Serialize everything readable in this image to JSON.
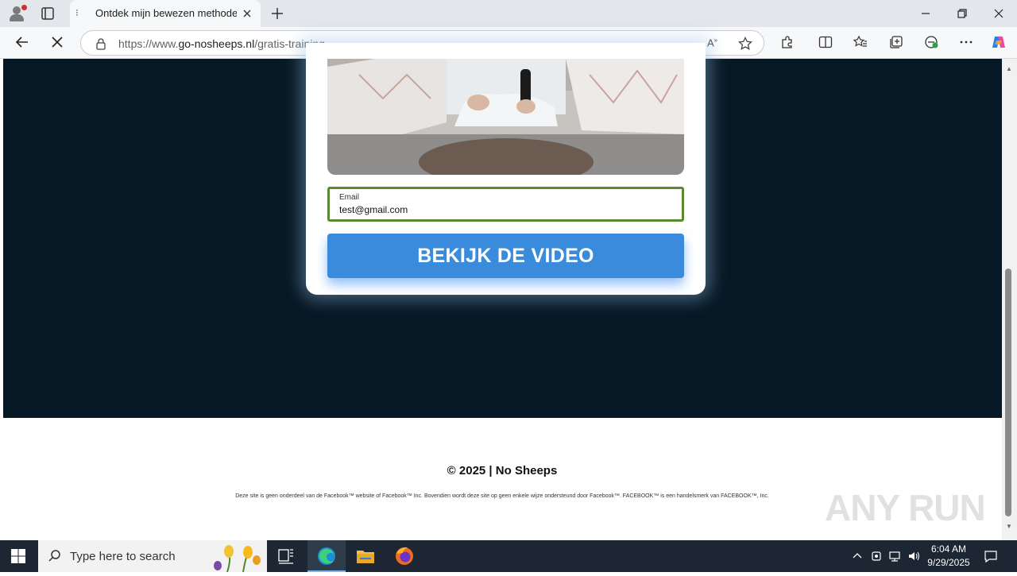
{
  "browser": {
    "tab_title": "Ontdek mijn bewezen methode -",
    "url_prefix": "https://www.",
    "url_domain": "go-nosheeps.nl",
    "url_path": "/gratis-training"
  },
  "page": {
    "email_label": "Email",
    "email_value": "test@gmail.com",
    "cta_label": "BEKIJK DE VIDEO",
    "footer_copyright": "© 2025 | No Sheeps",
    "footer_disclaimer": "Deze site is geen onderdeel van de Facebook™ website of Facebook™ Inc. Bovendien wordt deze site op geen enkele wijze ondersteund door Facebook™. FACEBOOK™ is een handelsmerk van FACEBOOK™, Inc."
  },
  "watermark": "ANY RUN",
  "taskbar": {
    "search_placeholder": "Type here to search",
    "time": "6:04 AM",
    "date": "9/29/2025"
  },
  "colors": {
    "page_dark_bg": "#061824",
    "cta_blue": "#3a8bdc",
    "email_border": "#5a8a2f"
  }
}
